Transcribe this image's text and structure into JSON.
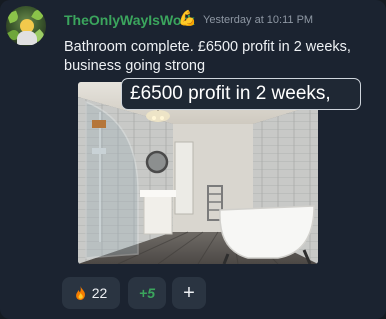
{
  "message": {
    "username": "TheOnlyWayIsWork",
    "username_icon": "flexed-biceps-icon",
    "username_icon_glyph": "💪",
    "timestamp": "Yesterday at 10:11 PM",
    "text": "Bathroom complete. £6500 profit in 2 weeks, business going strong"
  },
  "attachment": {
    "type": "image",
    "subject": "bathroom-photo",
    "overlay_caption": "£6500 profit in 2 weeks,"
  },
  "reactions": [
    {
      "icon": "fire-icon",
      "count": "22"
    },
    {
      "label": "+5"
    },
    {
      "icon": "add-reaction-icon",
      "label": "+"
    }
  ],
  "colors": {
    "background": "#1b2330",
    "username": "#3ba55d",
    "text": "#eef1f4",
    "timestamp": "#8e97a3",
    "reaction_bg": "#2a3441"
  }
}
